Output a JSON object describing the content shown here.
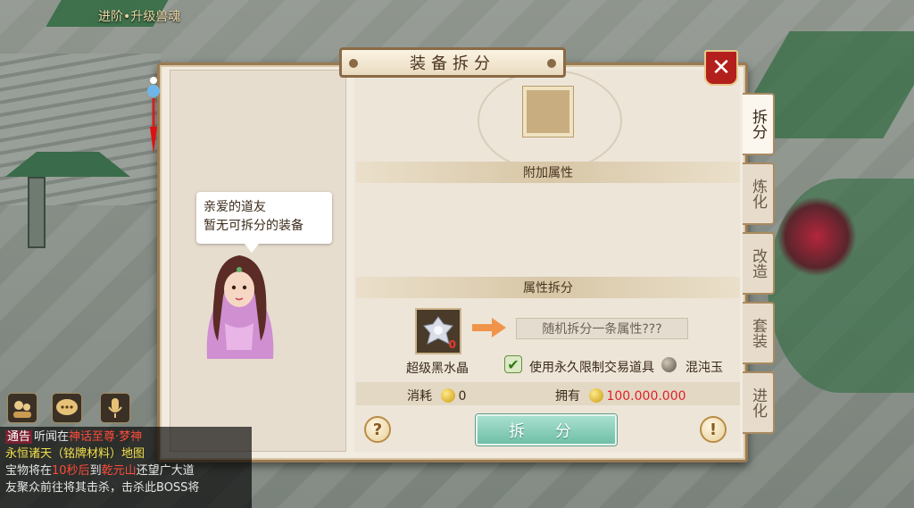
{
  "scene": {
    "top_banner": "进阶•升级兽魂"
  },
  "dialog": {
    "title": "装备拆分",
    "speech": {
      "line1": "亲爱的道友",
      "line2": "暂无可拆分的装备"
    },
    "sections": {
      "extra_attr": "附加属性",
      "attr_split": "属性拆分"
    },
    "material": {
      "name": "超级黑水晶",
      "count": "0"
    },
    "random_split": "随机拆分一条属性???",
    "use_permanent": "使用永久限制交易道具",
    "chaos_jade": "混沌玉",
    "cost_label": "消耗",
    "cost_value": "0",
    "own_label": "拥有",
    "own_value": "100.000.000",
    "split_button": "拆 分",
    "help": "?",
    "warn": "!"
  },
  "tabs": [
    {
      "label": "拆分",
      "active": true
    },
    {
      "label": "炼化",
      "active": false
    },
    {
      "label": "改造",
      "active": false
    },
    {
      "label": "套装",
      "active": false
    },
    {
      "label": "进化",
      "active": false
    }
  ],
  "chat": {
    "tag": "通告",
    "line1a": "听闻在",
    "line1b": "神话至尊·梦神",
    "line2": "永恒诸天（铭牌材料）地图",
    "line3a": "宝物将在",
    "line3b": "10秒后",
    "line3c": "到",
    "line3d": "乾元山",
    "line3e": "还望广大道",
    "line4": "友聚众前往将其击杀，击杀此BOSS将"
  },
  "colors": {
    "accent_red": "#b3201c",
    "own_value": "#e0202a",
    "button_green": "#7cc7ae"
  }
}
